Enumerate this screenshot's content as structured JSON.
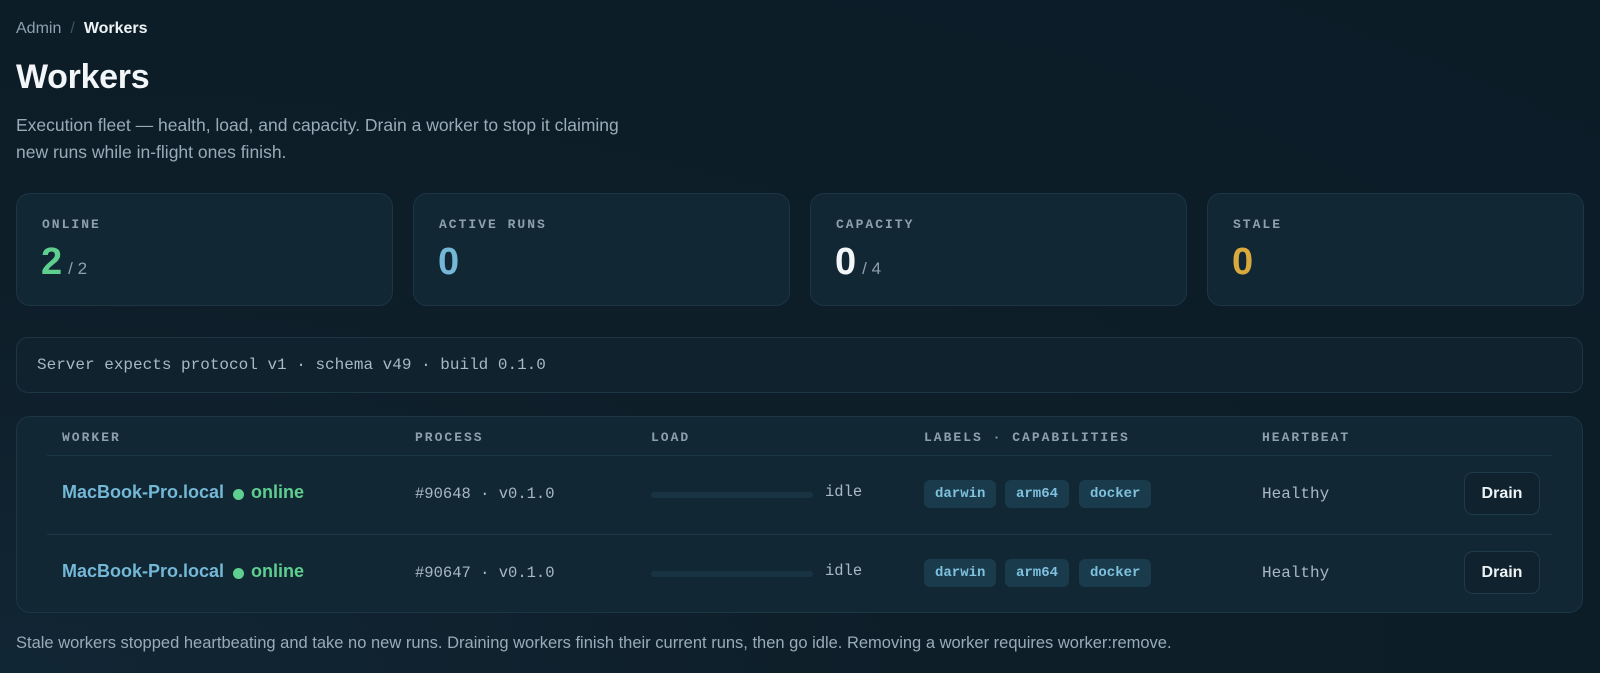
{
  "breadcrumb": {
    "parent": "Admin",
    "separator": "/",
    "current": "Workers"
  },
  "page": {
    "title": "Workers",
    "subtitle": "Execution fleet — health, load, and capacity. Drain a worker to stop it claiming new runs while in-flight ones finish."
  },
  "stats": {
    "online": {
      "label": "ONLINE",
      "value": "2",
      "total": "/ 2",
      "color": "#5fcf8f"
    },
    "active_runs": {
      "label": "ACTIVE RUNS",
      "value": "0",
      "color": "#74b7d6"
    },
    "capacity": {
      "label": "CAPACITY",
      "value": "0",
      "total": "/ 4",
      "color": "#f3f6f8"
    },
    "stale": {
      "label": "STALE",
      "value": "0",
      "color": "#d9a93e"
    }
  },
  "server_info": "Server expects protocol v1 · schema v49 · build 0.1.0",
  "table": {
    "headers": {
      "worker": "WORKER",
      "process": "PROCESS",
      "load": "LOAD",
      "labels": "LABELS · CAPABILITIES",
      "heartbeat": "HEARTBEAT"
    },
    "rows": [
      {
        "name": "MacBook-Pro.local",
        "status": "online",
        "process": "#90648 · v0.1.0",
        "load_fraction": 0,
        "load_text": "idle",
        "tags": [
          "darwin",
          "arm64",
          "docker"
        ],
        "heartbeat": "Healthy",
        "action": "Drain"
      },
      {
        "name": "MacBook-Pro.local",
        "status": "online",
        "process": "#90647 · v0.1.0",
        "load_fraction": 0,
        "load_text": "idle",
        "tags": [
          "darwin",
          "arm64",
          "docker"
        ],
        "heartbeat": "Healthy",
        "action": "Drain"
      }
    ]
  },
  "footer_note": "Stale workers stopped heartbeating and take no new runs. Draining workers finish their current runs, then go idle. Removing a worker requires worker:remove."
}
